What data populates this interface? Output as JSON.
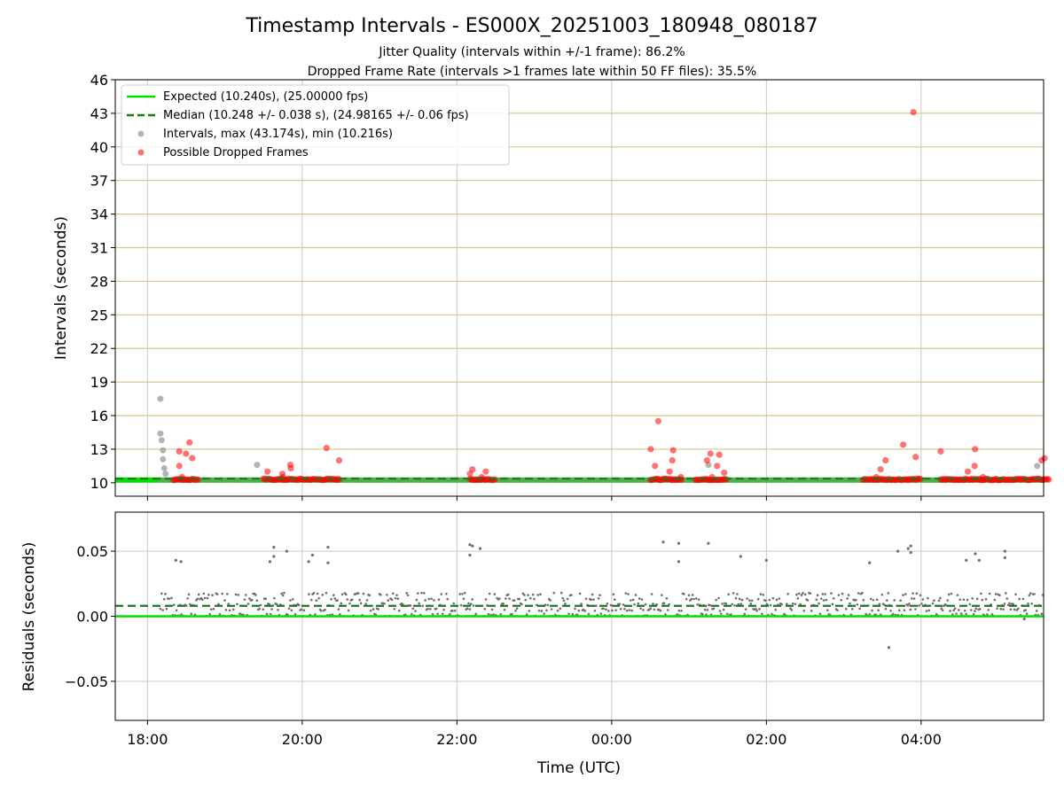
{
  "title": "Timestamp Intervals - ES000X_20251003_180948_080187",
  "subtitle_lines": [
    "Jitter Quality (intervals within +/-1 frame): 86.2%",
    "Dropped Frame Rate (intervals >1 frames late within 50 FF files): 35.5%"
  ],
  "colors": {
    "expected": "#00e000",
    "median": "#1a7a1a",
    "intervals": "#8c8c8c",
    "dropped": "#ff0000",
    "hgrid_top": "#d9c48a",
    "grid": "#c8c8c8"
  },
  "chart_data": [
    {
      "type": "scatter",
      "ylabel": "Intervals (seconds)",
      "ylim": [
        8.8,
        46
      ],
      "y_ticks": [
        10,
        13,
        16,
        19,
        22,
        25,
        28,
        31,
        34,
        37,
        40,
        43,
        46
      ],
      "grid": "on",
      "legend_position": "upper-left",
      "legend": [
        {
          "label": "Expected (10.240s), (25.00000 fps)",
          "style": "solid-line"
        },
        {
          "label": "Median (10.248 +/- 0.038 s), (24.98165 +/- 0.06 fps)",
          "style": "dashed-line"
        },
        {
          "label": "Intervals, max (43.174s), min (10.216s)",
          "style": "grey-dot"
        },
        {
          "label": "Possible Dropped Frames",
          "style": "red-dot"
        }
      ],
      "expected_value": 10.24,
      "median_value": 10.248,
      "dropped_clusters": [
        {
          "start": "18:20",
          "end": "18:40",
          "values": [
            10.5,
            11.5,
            12.2,
            12.6,
            12.8,
            13.6
          ]
        },
        {
          "start": "19:30",
          "end": "20:30",
          "values": [
            10.5,
            10.8,
            11.0,
            11.3,
            11.6,
            12.0,
            13.1
          ]
        },
        {
          "start": "22:10",
          "end": "22:30",
          "values": [
            10.5,
            10.8,
            11.0,
            11.2
          ]
        },
        {
          "start": "00:30",
          "end": "00:55",
          "values": [
            10.5,
            11.0,
            11.5,
            12.0,
            12.9,
            13.0,
            15.5
          ]
        },
        {
          "start": "01:05",
          "end": "01:30",
          "values": [
            10.5,
            10.9,
            11.5,
            12.0,
            12.5,
            12.6
          ]
        },
        {
          "start": "03:15",
          "end": "04:00",
          "values": [
            10.5,
            11.2,
            12.0,
            12.3,
            13.4,
            43.1
          ]
        },
        {
          "start": "04:15",
          "end": "05:40",
          "values": [
            10.5,
            11.0,
            11.5,
            12.0,
            12.2,
            12.8,
            13.0
          ]
        }
      ],
      "grey_points": [
        {
          "x": "18:10",
          "y": 17.5
        },
        {
          "x": "18:10",
          "y": 14.4
        },
        {
          "x": "18:11",
          "y": 13.8
        },
        {
          "x": "18:12",
          "y": 12.9
        },
        {
          "x": "18:12",
          "y": 12.1
        },
        {
          "x": "18:13",
          "y": 11.3
        },
        {
          "x": "18:14",
          "y": 10.8
        },
        {
          "x": "19:25",
          "y": 11.6
        },
        {
          "x": "01:15",
          "y": 11.6
        },
        {
          "x": "05:30",
          "y": 11.5
        }
      ]
    },
    {
      "type": "scatter",
      "xlabel": "Time (UTC)",
      "ylabel": "Residuals (seconds)",
      "ylim": [
        -0.08,
        0.08
      ],
      "y_ticks": [
        -0.05,
        0.0,
        0.05
      ],
      "y_tick_labels": [
        "−0.05",
        "0.00",
        "0.05"
      ],
      "x_tick_labels": [
        "18:00",
        "20:00",
        "22:00",
        "00:00",
        "02:00",
        "04:00"
      ],
      "x_range": [
        "17:35",
        "05:35"
      ],
      "grid": "on",
      "expected_residual": 0.0,
      "median_residual": 0.008,
      "residual_bands": [
        0.001,
        0.005,
        0.009,
        0.013,
        0.017
      ],
      "outliers": [
        {
          "x": "18:22",
          "y": 0.043
        },
        {
          "x": "18:26",
          "y": 0.042
        },
        {
          "x": "19:35",
          "y": 0.042
        },
        {
          "x": "19:38",
          "y": 0.053
        },
        {
          "x": "19:38",
          "y": 0.046
        },
        {
          "x": "19:48",
          "y": 0.05
        },
        {
          "x": "20:05",
          "y": 0.042
        },
        {
          "x": "20:08",
          "y": 0.047
        },
        {
          "x": "20:20",
          "y": 0.053
        },
        {
          "x": "20:20",
          "y": 0.041
        },
        {
          "x": "22:10",
          "y": 0.055
        },
        {
          "x": "22:12",
          "y": 0.054
        },
        {
          "x": "22:18",
          "y": 0.052
        },
        {
          "x": "22:10",
          "y": 0.047
        },
        {
          "x": "00:40",
          "y": 0.057
        },
        {
          "x": "00:52",
          "y": 0.056
        },
        {
          "x": "00:52",
          "y": 0.042
        },
        {
          "x": "01:15",
          "y": 0.056
        },
        {
          "x": "01:40",
          "y": 0.046
        },
        {
          "x": "02:00",
          "y": 0.043
        },
        {
          "x": "03:20",
          "y": 0.041
        },
        {
          "x": "03:35",
          "y": -0.024
        },
        {
          "x": "03:42",
          "y": 0.05
        },
        {
          "x": "03:50",
          "y": 0.052
        },
        {
          "x": "03:52",
          "y": 0.049
        },
        {
          "x": "03:52",
          "y": 0.054
        },
        {
          "x": "04:35",
          "y": 0.043
        },
        {
          "x": "04:42",
          "y": 0.048
        },
        {
          "x": "04:45",
          "y": 0.043
        },
        {
          "x": "05:05",
          "y": 0.05
        },
        {
          "x": "05:05",
          "y": 0.045
        },
        {
          "x": "05:20",
          "y": -0.002
        }
      ]
    }
  ]
}
